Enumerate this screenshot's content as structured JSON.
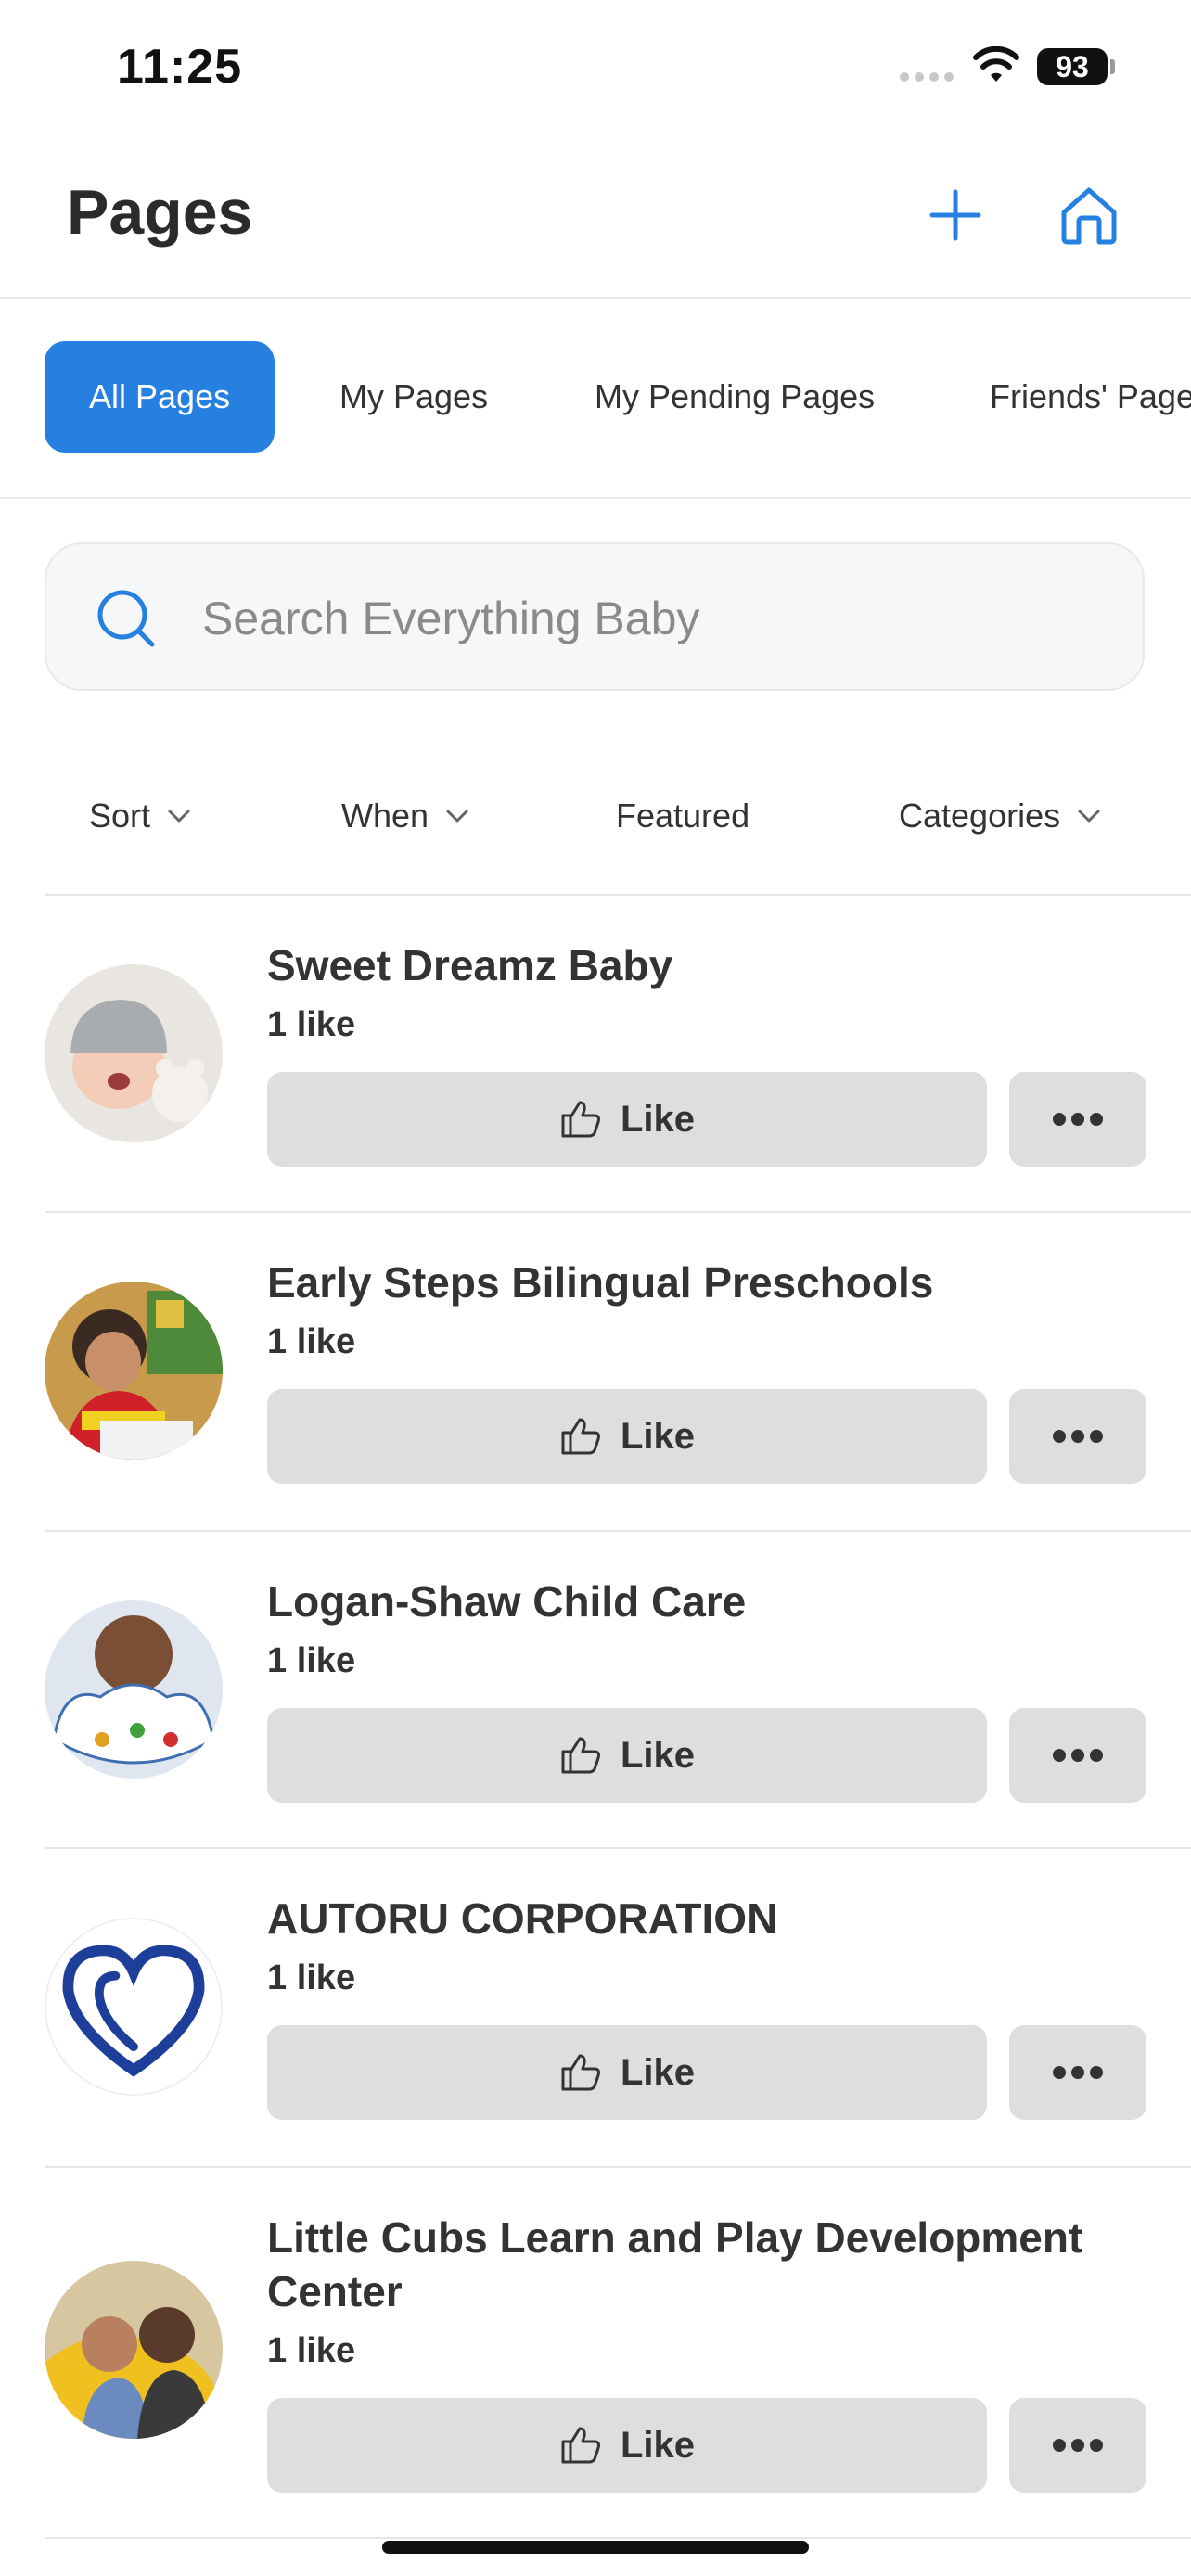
{
  "status_bar": {
    "time": "11:25",
    "battery": "93"
  },
  "header": {
    "title": "Pages"
  },
  "tabs": [
    {
      "label": "All Pages",
      "active": true
    },
    {
      "label": "My Pages",
      "active": false
    },
    {
      "label": "My Pending Pages",
      "active": false
    },
    {
      "label": "Friends' Pages",
      "active": false
    }
  ],
  "search": {
    "placeholder": "Search Everything Baby"
  },
  "filters": [
    {
      "label": "Sort",
      "dropdown": true
    },
    {
      "label": "When",
      "dropdown": true
    },
    {
      "label": "Featured",
      "dropdown": false
    },
    {
      "label": "Categories",
      "dropdown": true
    }
  ],
  "pages": [
    {
      "name": "Sweet Dreamz Baby",
      "likes": "1 like",
      "like_label": "Like"
    },
    {
      "name": "Early Steps Bilingual Preschools",
      "likes": "1 like",
      "like_label": "Like"
    },
    {
      "name": "Logan-Shaw Child Care",
      "likes": "1 like",
      "like_label": "Like"
    },
    {
      "name": "AUTORU CORPORATION",
      "likes": "1 like",
      "like_label": "Like"
    },
    {
      "name": "Little Cubs Learn and Play Development Center",
      "likes": "1 like",
      "like_label": "Like"
    }
  ],
  "colors": {
    "accent": "#2680e0",
    "button_bg": "#dedede",
    "divider": "#e6e6e6"
  }
}
